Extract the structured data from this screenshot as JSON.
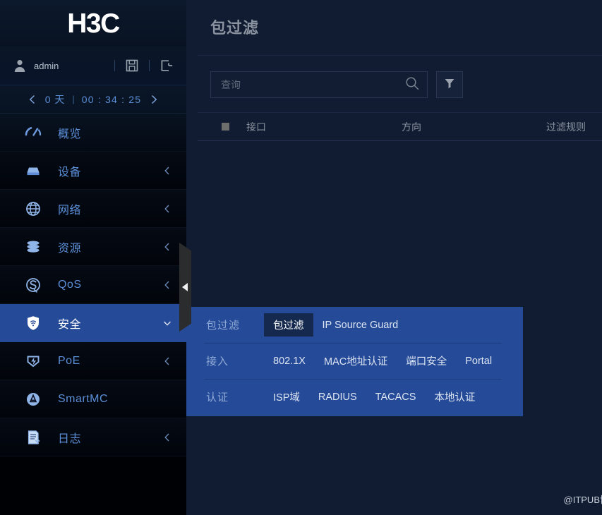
{
  "brand": {
    "logo_text": "H3C"
  },
  "user_bar": {
    "avatar_icon": "user-avatar-icon",
    "username": "admin",
    "save_icon": "floppy-disk-icon",
    "logout_icon": "logout-icon"
  },
  "timer_bar": {
    "prev_icon": "chevron-left-icon",
    "days_value": "0 天",
    "separator": "|",
    "clock_value": "00 : 34 : 25",
    "next_icon": "chevron-right-icon"
  },
  "sidebar": {
    "items": [
      {
        "label": "概览",
        "icon": "gauge-icon",
        "arrow": "none",
        "active": false
      },
      {
        "label": "设备",
        "icon": "device-icon",
        "arrow": "chevron-left",
        "active": false
      },
      {
        "label": "网络",
        "icon": "globe-icon",
        "arrow": "chevron-left",
        "active": false
      },
      {
        "label": "资源",
        "icon": "database-icon",
        "arrow": "chevron-left",
        "active": false
      },
      {
        "label": "QoS",
        "icon": "qos-icon",
        "arrow": "chevron-left",
        "active": false
      },
      {
        "label": "安全",
        "icon": "shield-icon",
        "arrow": "chevron-down",
        "active": true
      },
      {
        "label": "PoE",
        "icon": "poe-icon",
        "arrow": "chevron-left",
        "active": false
      },
      {
        "label": "SmartMC",
        "icon": "smartmc-icon",
        "arrow": "none",
        "active": false
      },
      {
        "label": "日志",
        "icon": "log-icon",
        "arrow": "chevron-left",
        "active": false
      }
    ]
  },
  "content": {
    "page_title": "包过滤",
    "search": {
      "placeholder": "查询",
      "value": "",
      "search_icon": "search-icon",
      "filter_icon": "filter-funnel-icon"
    },
    "table": {
      "select_all_checkbox": "select-all-checkbox",
      "columns": [
        "接口",
        "方向",
        "过滤规则"
      ],
      "rows": []
    }
  },
  "collapse_handle": {
    "icon": "triangle-left-icon"
  },
  "flyout": {
    "rows": [
      {
        "category": "包过滤",
        "links": [
          {
            "label": "包过滤",
            "selected": true
          },
          {
            "label": "IP Source Guard",
            "selected": false
          }
        ]
      },
      {
        "category": "接入",
        "links": [
          {
            "label": "802.1X",
            "selected": false
          },
          {
            "label": "MAC地址认证",
            "selected": false
          },
          {
            "label": "端口安全",
            "selected": false
          },
          {
            "label": "Portal",
            "selected": false
          }
        ]
      },
      {
        "category": "认证",
        "links": [
          {
            "label": "ISP域",
            "selected": false
          },
          {
            "label": "RADIUS",
            "selected": false
          },
          {
            "label": "TACACS",
            "selected": false
          },
          {
            "label": "本地认证",
            "selected": false
          }
        ]
      }
    ]
  },
  "watermark": {
    "text": "@ITPUB博客"
  },
  "colors": {
    "accent_blue": "#254a98",
    "nav_text": "#5b8fd8",
    "content_bg": "#111b31",
    "sidebar_bg": "#000104",
    "selected_tab_bg": "#15294f"
  }
}
